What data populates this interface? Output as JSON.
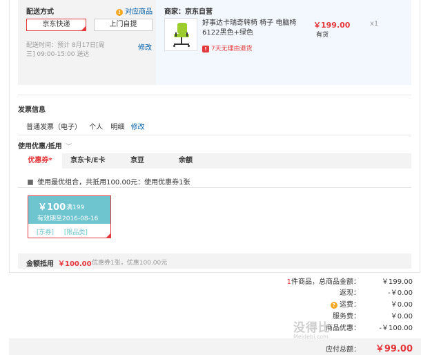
{
  "shipping": {
    "title": "配送方式",
    "items_link": "对应商品",
    "options": [
      "京东快递",
      "上门自提"
    ],
    "time_text_line1": "配送时间：预计 8月17日[周",
    "time_text_line2": "三] 09:00-15:00 送达",
    "edit_label": "修改"
  },
  "merchant": {
    "label": "商家：京东自营",
    "product_name_line1": "好事达卡瑞奇转椅 椅子 电脑椅",
    "product_name_line2": "6122黑色+绿色",
    "price": "￥199.00",
    "stock": "有货",
    "qty": "x1",
    "return_badge": "7天无理由退货",
    "return_icon": "!"
  },
  "invoice": {
    "title": "发票信息",
    "type": "普通发票（电子）",
    "person": "个人",
    "content": "明细",
    "edit_label": "修改"
  },
  "coupons": {
    "title": "使用优惠/抵用",
    "tabs": [
      "优惠券*",
      "京东卡/E卡",
      "京豆",
      "余额"
    ],
    "best_combo_text": "使用最优组合，共抵用100.00元：使用优惠券1张",
    "card": {
      "amount": "￥100",
      "condition": "满199",
      "expiry": "有效期至2016-08-16",
      "tag1": "[东券]",
      "tag2": "[限品类]"
    },
    "deduct_label": "金额抵用",
    "deduct_amount": "￥100.00",
    "deduct_detail": "优惠券1张，优惠100.00元"
  },
  "summary": {
    "count_prefix": "1",
    "count_label": "件商品，总商品金额：",
    "goods_total": "￥199.00",
    "rebate_label": "返现：",
    "rebate": "-￥0.00",
    "freight_label": "运费：",
    "freight": "￥0.00",
    "service_label": "服务费：",
    "service": "￥0.00",
    "discount_label": "商品优惠：",
    "discount": "-￥100.00",
    "payable_label": "应付总额：",
    "payable": "￥99.00"
  },
  "watermark": {
    "text": "没得比",
    "sub": "Meidebi.com"
  },
  "colors": {
    "accent_red": "#e4393c",
    "link_blue": "#005ea7",
    "coupon_teal": "#6ec5cf"
  }
}
